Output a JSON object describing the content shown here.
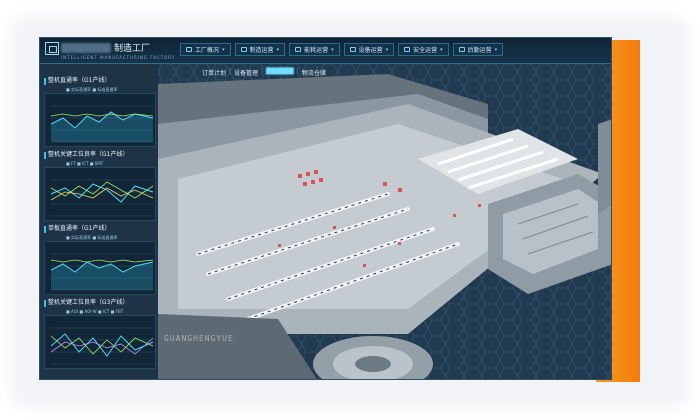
{
  "header": {
    "title": "制造工厂",
    "subtitle": "INTELLIGENT MANUFACTURING FACTORY"
  },
  "menu": [
    {
      "label": "工厂概况"
    },
    {
      "label": "制造运营"
    },
    {
      "label": "能耗运营"
    },
    {
      "label": "设备运营"
    },
    {
      "label": "安全运营"
    },
    {
      "label": "后勤运营"
    }
  ],
  "subnav": [
    {
      "label": "订单计划"
    },
    {
      "label": "设备管理"
    },
    {
      "label": "物流仓储"
    }
  ],
  "panels": [
    {
      "title": "整机直通率（G1产线）",
      "legend": "■ 实际直通率  ■ 标准直通率"
    },
    {
      "title": "整机关键工位良率（G1产线）",
      "legend": "■ FT  ■ ICT  ■ SMT"
    },
    {
      "title": "单板直通率（G1产线）",
      "legend": "■ 实际直通率  ■ 标准直通率"
    },
    {
      "title": "整机关键工位良率（G3产线）",
      "legend": "■ AOI  ■ AOI-W  ■ ICT  ■ FBT"
    }
  ],
  "watermark": "GUANGHENGYUE",
  "colors": {
    "accent": "#34c3ef",
    "orange": "#f47c0c",
    "screen_bg": "#1e3346"
  }
}
